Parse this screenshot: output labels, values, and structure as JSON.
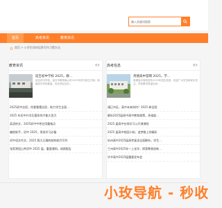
{
  "search": {
    "placeholder": "输入关键词搜索"
  },
  "nav": {
    "items": [
      {
        "label": "首页"
      },
      {
        "label": "高考资讯"
      },
      {
        "label": "教育资讯"
      }
    ]
  },
  "breadcrumb": {
    "text": "首页 > 小学生如何培养写作习惯方法"
  },
  "left_panel": {
    "title": "教育资讯",
    "more": "更多",
    "featured": {
      "title": "延吉初中学校 2025，教...",
      "desc": "延吉初中学校，延吉市教育局公布2025年初中招生方案，新增初中学校数量，优化学区划分..."
    },
    "list": [
      "2025初中志愿，你要看懂志愿，助力学生全面...",
      "2025 年初中升学后要如何才能大显力",
      "英语听文，2025初中中考应用重难点",
      "编程新手，初中 2025，男孩学习必备",
      "初中语文作文，2025 版大正确的结构助力写作",
      "张家港昆山考初中 2025 届，重要通知，成绩报告"
    ]
  },
  "right_panel": {
    "title": "高考信息",
    "more": "更多",
    "featured": {
      "title": "英德高中官网 2025，学...",
      "desc": "英德高中官网发布2025年招生信息，欢迎广大学生和家长关注，学校教学质量优良..."
    },
    "list": [
      "通辽市区，高中未来如何？2025 新征程",
      "解析2025届高中高中教育政策，多维度...",
      "2025 届高中在线学习公开课课程",
      "2025 届高中校园小结，追梦路上的精彩",
      "杭州高中2025届高考复读全面解析，学生...",
      "兰州高中2025年一上化学，探索教育创新...",
      "毕节高中2025届重要发布会"
    ]
  },
  "watermark": {
    "text": "小玫导航 - 秒收"
  },
  "colors": {
    "accent": "#ff7f2a",
    "nav_active": "#ff9a4a"
  }
}
